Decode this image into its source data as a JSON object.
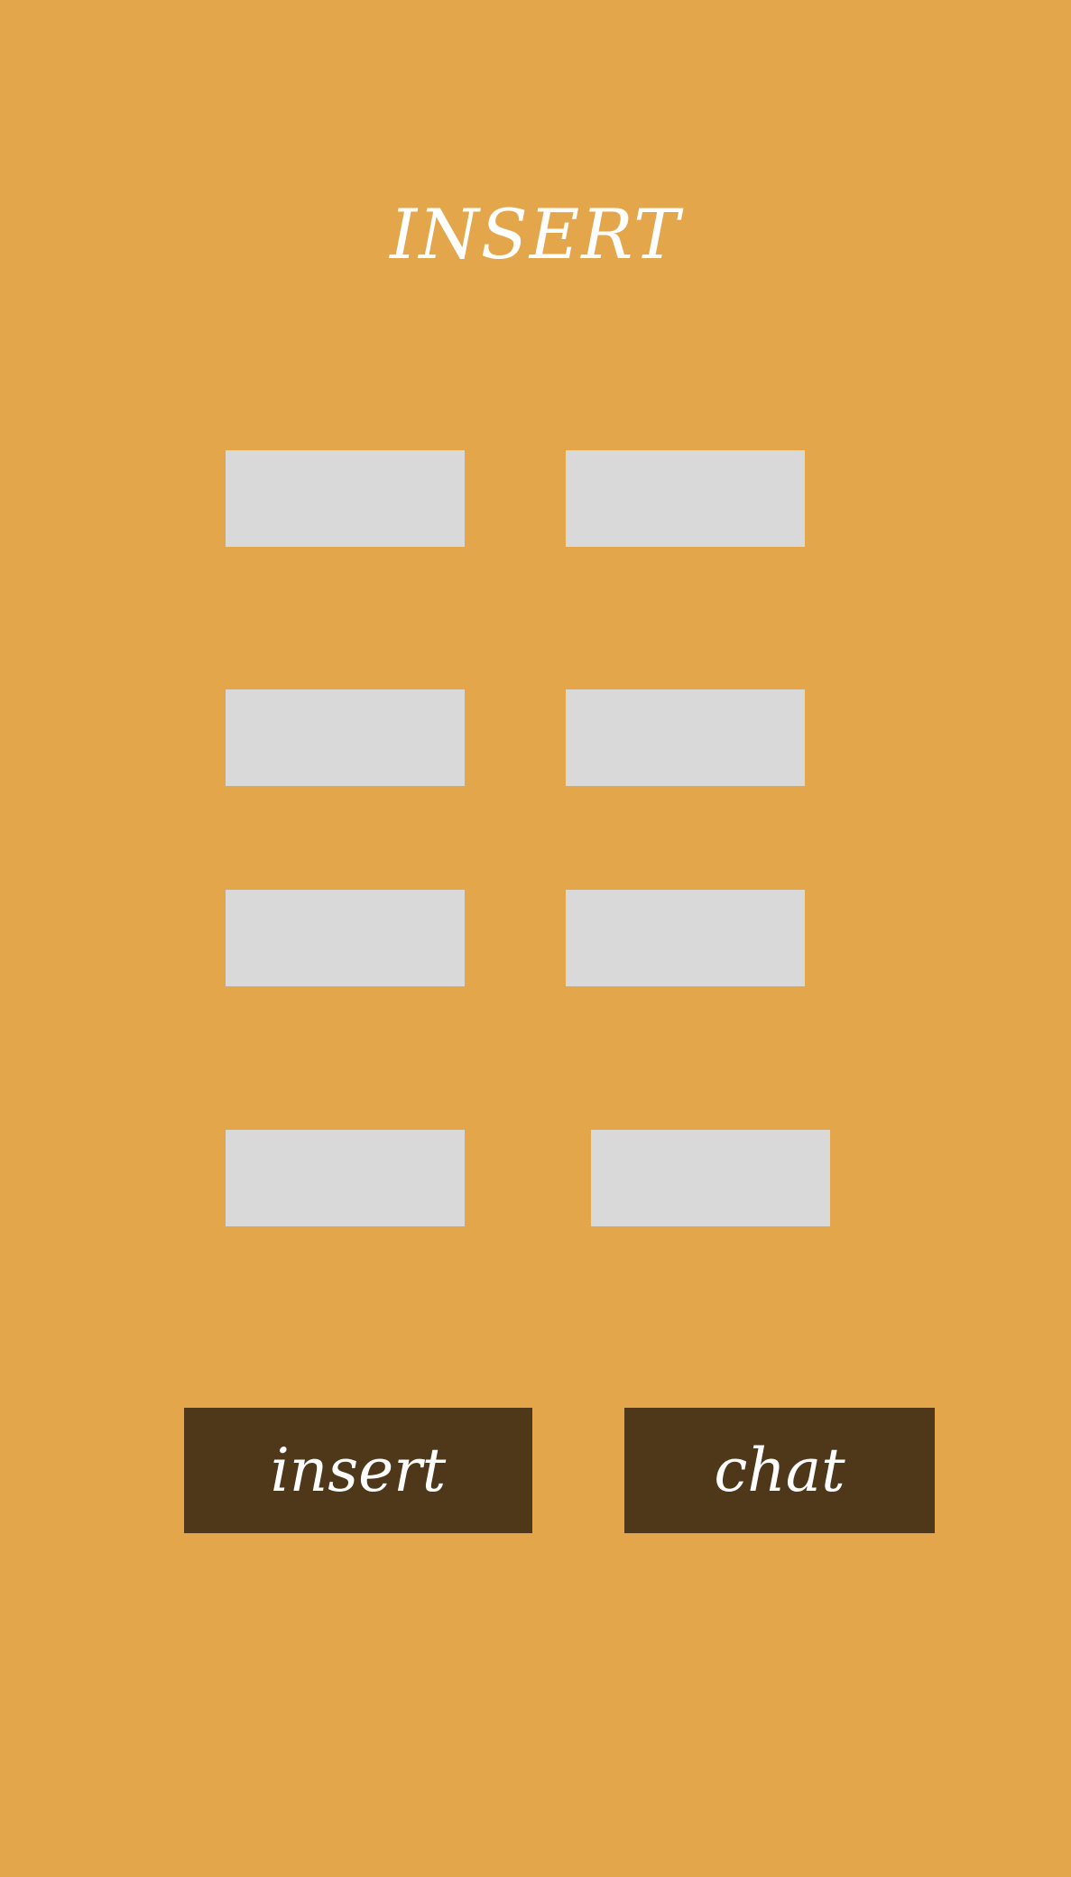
{
  "header": {
    "title": "INSERT"
  },
  "form": {
    "fields": [
      {
        "name": "field-1",
        "value": "",
        "placeholder": ""
      },
      {
        "name": "field-2",
        "value": "",
        "placeholder": ""
      },
      {
        "name": "field-3",
        "value": "",
        "placeholder": ""
      },
      {
        "name": "field-4",
        "value": "",
        "placeholder": ""
      },
      {
        "name": "field-5",
        "value": "",
        "placeholder": ""
      },
      {
        "name": "field-6",
        "value": "",
        "placeholder": ""
      },
      {
        "name": "field-7",
        "value": "",
        "placeholder": ""
      },
      {
        "name": "field-8",
        "value": "",
        "placeholder": ""
      }
    ]
  },
  "actions": {
    "insert_label": "insert",
    "chat_label": "chat"
  },
  "colors": {
    "background": "#e4a64a",
    "field": "#d9d9d9",
    "button": "#4f3719",
    "text": "#ffffff"
  }
}
